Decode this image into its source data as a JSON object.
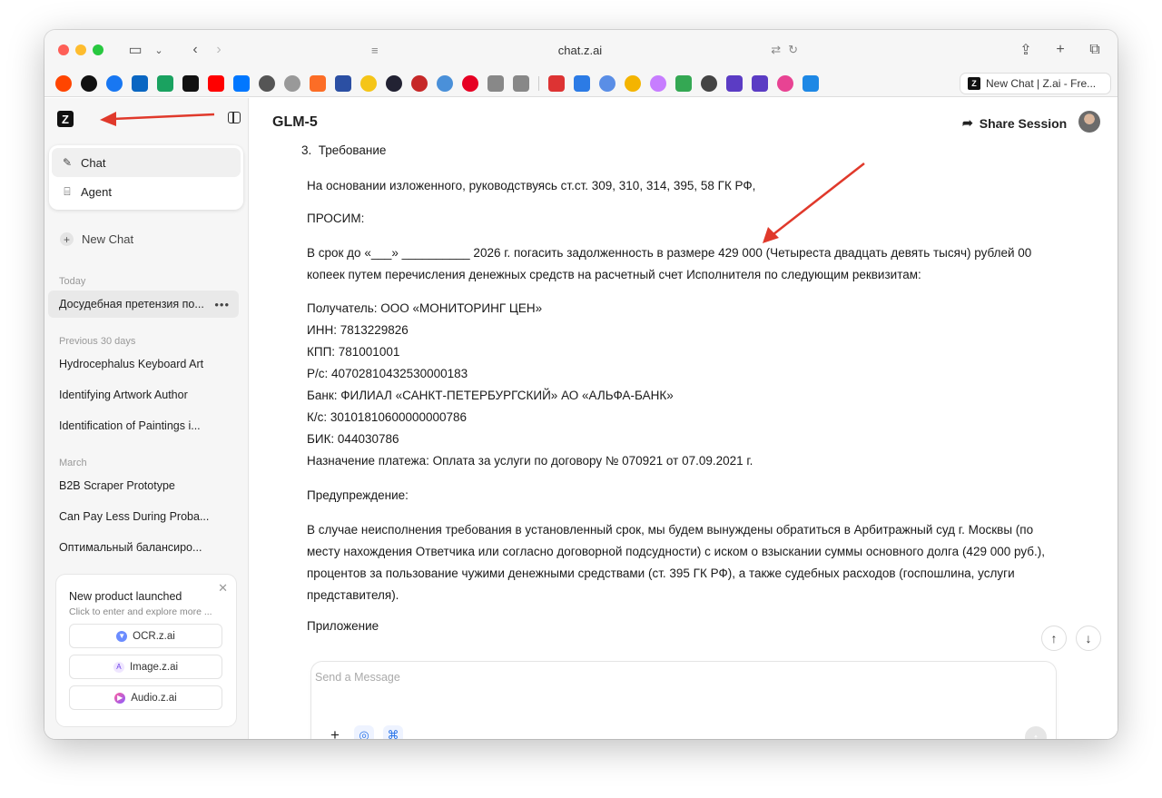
{
  "browser": {
    "url": "chat.z.ai",
    "tab_title": "New Chat | Z.ai - Fre..."
  },
  "sidebar": {
    "logo": "Z",
    "modes": [
      {
        "label": "Chat",
        "icon": "edit-icon"
      },
      {
        "label": "Agent",
        "icon": "agent-icon"
      }
    ],
    "new_chat": "New Chat",
    "sections": [
      {
        "title": "Today",
        "items": [
          "Досудебная претензия по..."
        ]
      },
      {
        "title": "Previous 30 days",
        "items": [
          "Hydrocephalus Keyboard Art",
          "Identifying Artwork Author",
          "Identification of Paintings i..."
        ]
      },
      {
        "title": "March",
        "items": [
          "B2B Scraper Prototype",
          "Can Pay Less During Proba...",
          "Оптимальный балансиро..."
        ]
      }
    ],
    "promo": {
      "title": "New product launched",
      "subtitle": "Click to enter and explore more ...",
      "buttons": [
        "OCR.z.ai",
        "Image.z.ai",
        "Audio.z.ai"
      ]
    }
  },
  "header": {
    "model": "GLM-5",
    "share": "Share Session"
  },
  "document": {
    "item_number": "3.",
    "item_title": "Требование",
    "p1": "На основании изложенного, руководствуясь ст.ст. 309, 310, 314, 395, 58 ГК РФ,",
    "p2": "ПРОСИМ:",
    "p3": "В срок до «___» __________ 2026 г. погасить задолженность в размере 429 000 (Четыреста двадцать девять тысяч) рублей 00 копеек путем перечисления денежных средств на расчетный счет Исполнителя по следующим реквизитам:",
    "details": [
      "Получатель: ООО «МОНИТОРИНГ ЦЕН»",
      "ИНН: 7813229826",
      "КПП: 781001001",
      "Р/с: 40702810432530000183",
      "Банк: ФИЛИАЛ «САНКТ-ПЕТЕРБУРГСКИЙ» АО «АЛЬФА-БАНК»",
      "К/с: 30101810600000000786",
      "БИК: 044030786",
      "Назначение платежа: Оплата за услуги по договору № 070921 от 07.09.2021 г."
    ],
    "p4": "Предупреждение:",
    "p5": "В случае неисполнения требования в установленный срок, мы будем вынуждены обратиться в Арбитражный суд г. Москвы (по месту нахождения Ответчика или согласно договорной подсудности) с иском о взыскании суммы основного долга (429 000 руб.), процентов за пользование чужими денежными средствами (ст. 395 ГК РФ), а также судебных расходов (госпошлина, услуги представителя).",
    "p6": "Приложение"
  },
  "composer": {
    "placeholder": "Send a Message"
  },
  "colors": {
    "annotation_arrow": "#e0392b",
    "accent_blue": "#2a74e8"
  }
}
